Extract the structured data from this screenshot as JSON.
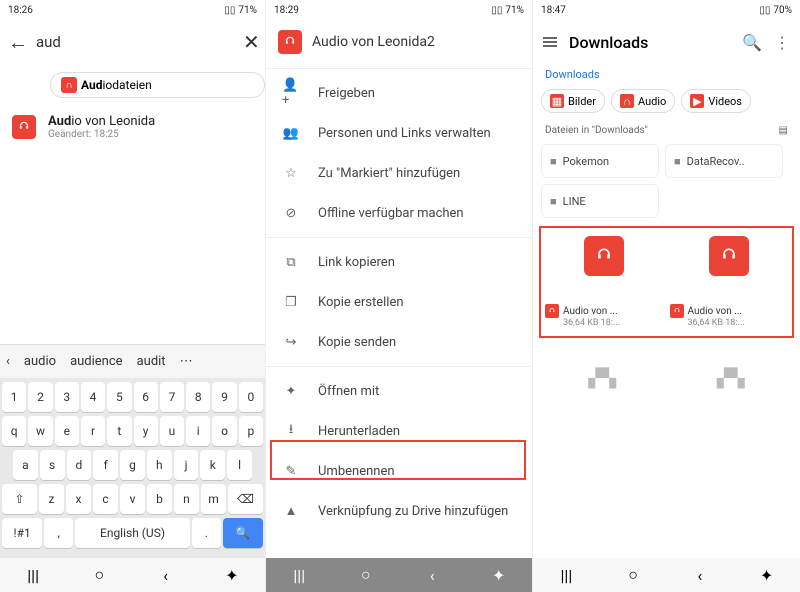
{
  "s1": {
    "status": {
      "time": "18:26",
      "battery": "71%"
    },
    "search_value": "aud",
    "chip_label": "Audiodateien",
    "result": {
      "title_bold": "Aud",
      "title_rest": "io von Leonida",
      "sub": "Geändert: 18:25"
    },
    "suggestions": [
      "audio",
      "audience",
      "audit"
    ],
    "keyboard_lang": "English (US)"
  },
  "s2": {
    "status": {
      "time": "18:29",
      "battery": "71%"
    },
    "header": "Audio von Leonida2",
    "items": [
      {
        "icon": "share",
        "label": "Freigeben"
      },
      {
        "icon": "people",
        "label": "Personen und Links verwalten"
      },
      {
        "icon": "star",
        "label": "Zu \"Markiert\" hinzufügen"
      },
      {
        "icon": "offline",
        "label": "Offline verfügbar machen"
      },
      {
        "icon": "copy",
        "label": "Link kopieren"
      },
      {
        "icon": "duplicate",
        "label": "Kopie erstellen"
      },
      {
        "icon": "send",
        "label": "Kopie senden"
      },
      {
        "icon": "open",
        "label": "Öffnen mit"
      },
      {
        "icon": "download",
        "label": "Herunterladen"
      },
      {
        "icon": "rename",
        "label": "Umbenennen"
      },
      {
        "icon": "drive",
        "label": "Verknüpfung zu Drive hinzufügen"
      }
    ]
  },
  "s3": {
    "status": {
      "time": "18:47",
      "battery": "70%"
    },
    "title": "Downloads",
    "breadcrumb": "Downloads",
    "chips": [
      {
        "label": "Bilder",
        "color": "#ea4335"
      },
      {
        "label": "Audio",
        "color": "#ea4335"
      },
      {
        "label": "Videos",
        "color": "#ea4335"
      }
    ],
    "section": "Dateien in \"Downloads\"",
    "folders": [
      "Pokemon",
      "DataRecov..",
      "LINE"
    ],
    "files": [
      {
        "name": "Audio von ...",
        "size": "36,64 KB 18:..."
      },
      {
        "name": "Audio von ...",
        "size": "36,64 KB 18:..."
      }
    ]
  }
}
